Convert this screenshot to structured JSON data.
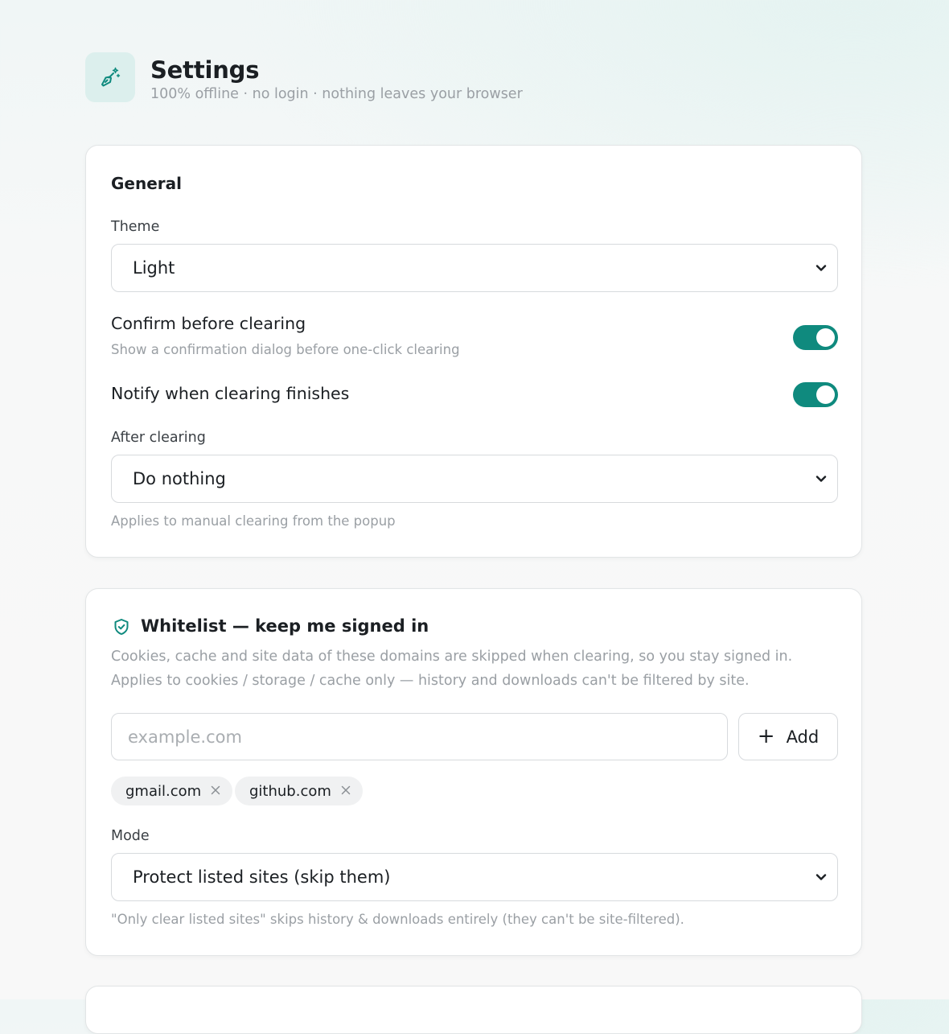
{
  "header": {
    "title": "Settings",
    "subtitle": "100% offline · no login · nothing leaves your browser",
    "logo_icon": "broom-sparkle-icon"
  },
  "colors": {
    "accent": "#0f8a7e",
    "muted_text": "#9a9fa4",
    "logo_bg": "#dcefed"
  },
  "general": {
    "title": "General",
    "theme_label": "Theme",
    "theme_value": "Light",
    "confirm_title": "Confirm before clearing",
    "confirm_hint": "Show a confirmation dialog before one-click clearing",
    "confirm_on": true,
    "notify_title": "Notify when clearing finishes",
    "notify_on": true,
    "after_label": "After clearing",
    "after_value": "Do nothing",
    "after_hint": "Applies to manual clearing from the popup"
  },
  "whitelist": {
    "icon": "shield-check-icon",
    "title": "Whitelist — keep me signed in",
    "description": "Cookies, cache and site data of these domains are skipped when clearing, so you stay signed in. Applies to cookies / storage / cache only — history and downloads can't be filtered by site.",
    "input_placeholder": "example.com",
    "add_label": "Add",
    "domains": [
      "gmail.com",
      "github.com"
    ],
    "mode_label": "Mode",
    "mode_value": "Protect listed sites (skip them)",
    "mode_hint": "\"Only clear listed sites\" skips history & downloads entirely (they can't be site-filtered)."
  }
}
